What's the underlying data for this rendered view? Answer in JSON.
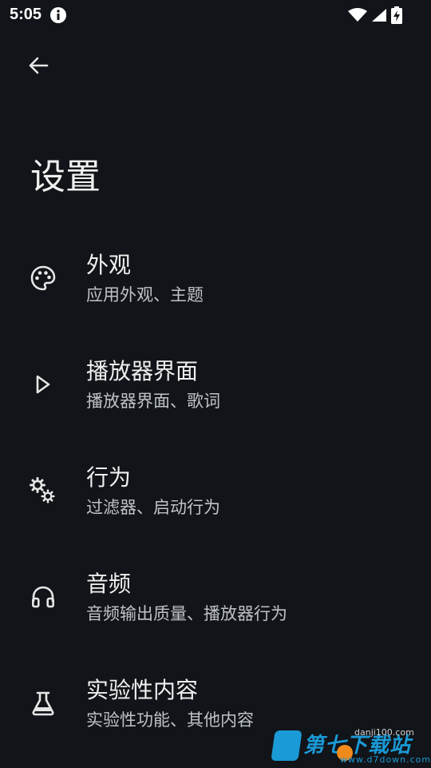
{
  "status_bar": {
    "time": "5:05"
  },
  "header": {
    "title": "设置"
  },
  "settings": [
    {
      "title": "外观",
      "subtitle": "应用外观、主题",
      "icon": "palette-icon"
    },
    {
      "title": "播放器界面",
      "subtitle": "播放器界面、歌词",
      "icon": "play-icon"
    },
    {
      "title": "行为",
      "subtitle": "过滤器、启动行为",
      "icon": "gears-icon"
    },
    {
      "title": "音频",
      "subtitle": "音频输出质量、播放器行为",
      "icon": "headphones-icon"
    },
    {
      "title": "实验性内容",
      "subtitle": "实验性功能、其他内容",
      "icon": "flask-icon"
    }
  ],
  "watermark": {
    "brand": "第七下载站",
    "site": "danji100.com",
    "url": "www.d7down.com"
  },
  "colors": {
    "background": "#111418",
    "text_primary": "#f0f0f0",
    "text_secondary": "#bfc3c8",
    "watermark_blue": "#1a9ad6",
    "watermark_orange": "#f08a1c"
  }
}
